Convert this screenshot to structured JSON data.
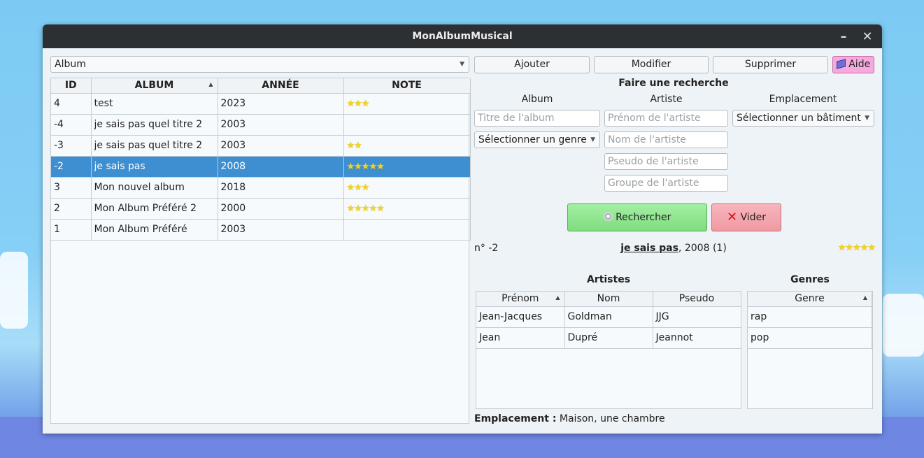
{
  "window": {
    "title": "MonAlbumMusical"
  },
  "left": {
    "view_selector": "Album",
    "columns": [
      "ID",
      "ALBUM",
      "ANNÉE",
      "NOTE"
    ],
    "rows": [
      {
        "id": "4",
        "album": "test",
        "year": "2023",
        "rating": 3
      },
      {
        "id": "-4",
        "album": "je sais pas quel titre 2",
        "year": "2003",
        "rating": 0
      },
      {
        "id": "-3",
        "album": "je sais pas quel titre 2",
        "year": "2003",
        "rating": 2
      },
      {
        "id": "-2",
        "album": "je sais pas",
        "year": "2008",
        "rating": 5,
        "selected": true
      },
      {
        "id": "3",
        "album": "Mon nouvel album",
        "year": "2018",
        "rating": 3
      },
      {
        "id": "2",
        "album": "Mon Album Préféré 2",
        "year": "2000",
        "rating": 5
      },
      {
        "id": "1",
        "album": "Mon Album Préféré",
        "year": "2003",
        "rating": 0
      }
    ]
  },
  "toolbar": {
    "add_label": "Ajouter",
    "edit_label": "Modifier",
    "delete_label": "Supprimer",
    "help_label": "Aide"
  },
  "search": {
    "title": "Faire une recherche",
    "album_heading": "Album",
    "artist_heading": "Artiste",
    "location_heading": "Emplacement",
    "album_title_placeholder": "Titre de l'album",
    "genre_select": "Sélectionner un genre",
    "firstname_placeholder": "Prénom de l'artiste",
    "lastname_placeholder": "Nom de l'artiste",
    "nickname_placeholder": "Pseudo de l'artiste",
    "group_placeholder": "Groupe de l'artiste",
    "building_select": "Sélectionner un bâtiment",
    "search_label": "Rechercher",
    "clear_label": "Vider"
  },
  "detail": {
    "number": "n° -2",
    "album_name": "je sais pas",
    "album_meta": ", 2008 (1)",
    "rating": 5,
    "artists_heading": "Artistes",
    "genres_heading": "Genres",
    "artist_columns": [
      "Prénom",
      "Nom",
      "Pseudo"
    ],
    "artists": [
      {
        "firstname": "Jean-Jacques",
        "lastname": "Goldman",
        "nickname": "JJG"
      },
      {
        "firstname": "Jean",
        "lastname": "Dupré",
        "nickname": "Jeannot"
      }
    ],
    "genre_column": "Genre",
    "genres": [
      "rap",
      "pop"
    ],
    "location_label": "Emplacement :",
    "location_value": "Maison, une chambre"
  },
  "colors": {
    "selection": "#3d8fd1",
    "search_button": "#8fe88f",
    "clear_button": "#f5a8b0",
    "help_button": "#f5a9dc",
    "titlebar": "#2d3033"
  }
}
